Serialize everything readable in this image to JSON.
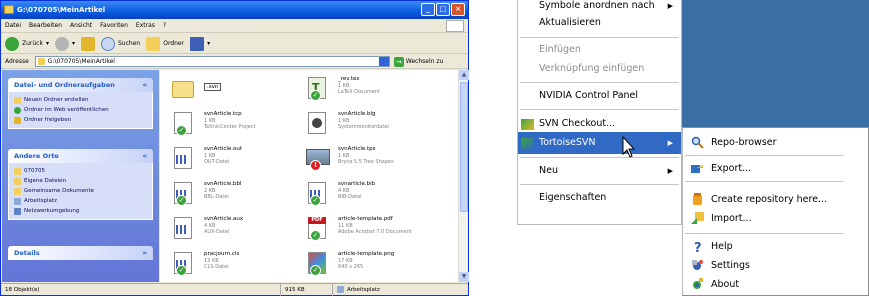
{
  "explorer": {
    "title": "G:\\070705\\MeinArtikel",
    "menu": [
      "Datei",
      "Bearbeiten",
      "Ansicht",
      "Favoriten",
      "Extras",
      "?"
    ],
    "toolbar": {
      "back_label": "Zurück",
      "search_label": "Suchen",
      "folders_label": "Ordner"
    },
    "address": {
      "label": "Adresse",
      "value": "G:\\070705\\MeinArtikel",
      "go_label": "Wechseln zu"
    },
    "tasks": {
      "title": "Datei- und Ordneraufgaben",
      "items": [
        "Neuen Ordner erstellen",
        "Ordner im Web veröffentlichen",
        "Ordner freigeben"
      ]
    },
    "places": {
      "title": "Andere Orte",
      "items": [
        "070705",
        "Eigene Dateien",
        "Gemeinsame Dokumente",
        "Arbeitsplatz",
        "Netzwerkumgebung"
      ]
    },
    "details": {
      "title": "Details"
    },
    "files": [
      {
        "name": ".svn",
        "size": "",
        "type": ""
      },
      {
        "name": "_rev.tex",
        "size": "1 KB",
        "type": "LaTeX Document"
      },
      {
        "name": "svnArticle.tcp",
        "size": "1 KB",
        "type": "TeXnicCenter Project"
      },
      {
        "name": "svnArticle.blg",
        "size": "1 KB",
        "type": "Systemmonitordatei"
      },
      {
        "name": "svnArticle.out",
        "size": "1 KB",
        "type": "OUT-Datei"
      },
      {
        "name": "svnArticle.tps",
        "size": "1 KB",
        "type": "Bryce 5.5 Tree Shapes"
      },
      {
        "name": "svnArticle.bbl",
        "size": "2 KB",
        "type": "BBL-Datei"
      },
      {
        "name": "svnarticle.bib",
        "size": "4 KB",
        "type": "BIB-Datei"
      },
      {
        "name": "svnArticle.aux",
        "size": "4 KB",
        "type": "AUX-Datei"
      },
      {
        "name": "article-template.pdf",
        "size": "11 KB",
        "type": "Adobe Acrobat 7.0 Document"
      },
      {
        "name": "pracjourn.cls",
        "size": "13 KB",
        "type": "CLS-Datei"
      },
      {
        "name": "article-template.png",
        "size": "17 KB",
        "type": "640 x 265"
      }
    ],
    "status": {
      "count": "18 Objekt(e)",
      "size": "915 KB",
      "location": "Arbeitsplatz"
    }
  },
  "context_menu": {
    "items": [
      {
        "label": "Symbole anordnen nach",
        "submenu": true
      },
      {
        "label": "Aktualisieren"
      },
      {
        "label": "Einfügen",
        "disabled": true
      },
      {
        "label": "Verknüpfung einfügen",
        "disabled": true
      },
      {
        "label": "NVIDIA Control Panel"
      },
      {
        "label": "SVN Checkout..."
      },
      {
        "label": "TortoiseSVN",
        "submenu": true,
        "highlighted": true
      },
      {
        "label": "Neu",
        "submenu": true
      },
      {
        "label": "Eigenschaften"
      }
    ]
  },
  "tortoise_submenu": {
    "items": [
      {
        "label": "Repo-browser",
        "icon": "magnifier-icon"
      },
      {
        "label": "Export...",
        "icon": "export-icon"
      },
      {
        "label": "Create repository here...",
        "icon": "repository-icon"
      },
      {
        "label": "Import...",
        "icon": "import-icon"
      },
      {
        "label": "Help",
        "icon": "help-icon"
      },
      {
        "label": "Settings",
        "icon": "settings-icon"
      },
      {
        "label": "About",
        "icon": "about-icon"
      }
    ]
  },
  "colors": {
    "xp_blue": "#0a5ae0",
    "highlight": "#316ac5",
    "desktop": "#3a6ea5",
    "taskpane": "#6375d6"
  }
}
